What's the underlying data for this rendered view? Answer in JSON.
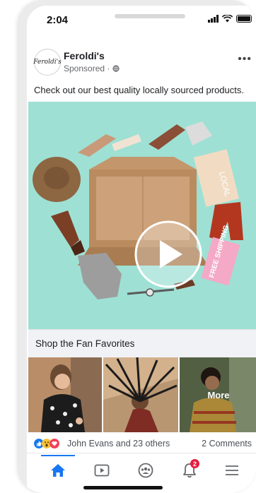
{
  "status_bar": {
    "time": "2:04"
  },
  "post": {
    "page_name": "Feroldi's",
    "avatar_text": "Feroldi's",
    "sponsored_label": "Sponsored",
    "caption": "Check out our best quality locally sourced products.",
    "media_labels": {
      "local_box": "LOCAL",
      "free_shipping_box": "FREE SHIPPING"
    }
  },
  "shop_section": {
    "title": "Shop the Fan Favorites",
    "more_label": "More"
  },
  "engagement": {
    "reactions_text": "John Evans and 23 others",
    "comments_text": "2 Comments",
    "reaction_icons": [
      "like-icon",
      "wow-icon",
      "love-icon"
    ]
  },
  "tabbar": {
    "items": [
      "home-icon",
      "video-icon",
      "groups-icon",
      "notifications-icon",
      "menu-icon"
    ],
    "notifications_badge": "2",
    "active_color": "#1877f2"
  },
  "colors": {
    "media_background": "#9fe0d4",
    "brand_blue": "#1877f2",
    "badge_red": "#e41e3f"
  }
}
